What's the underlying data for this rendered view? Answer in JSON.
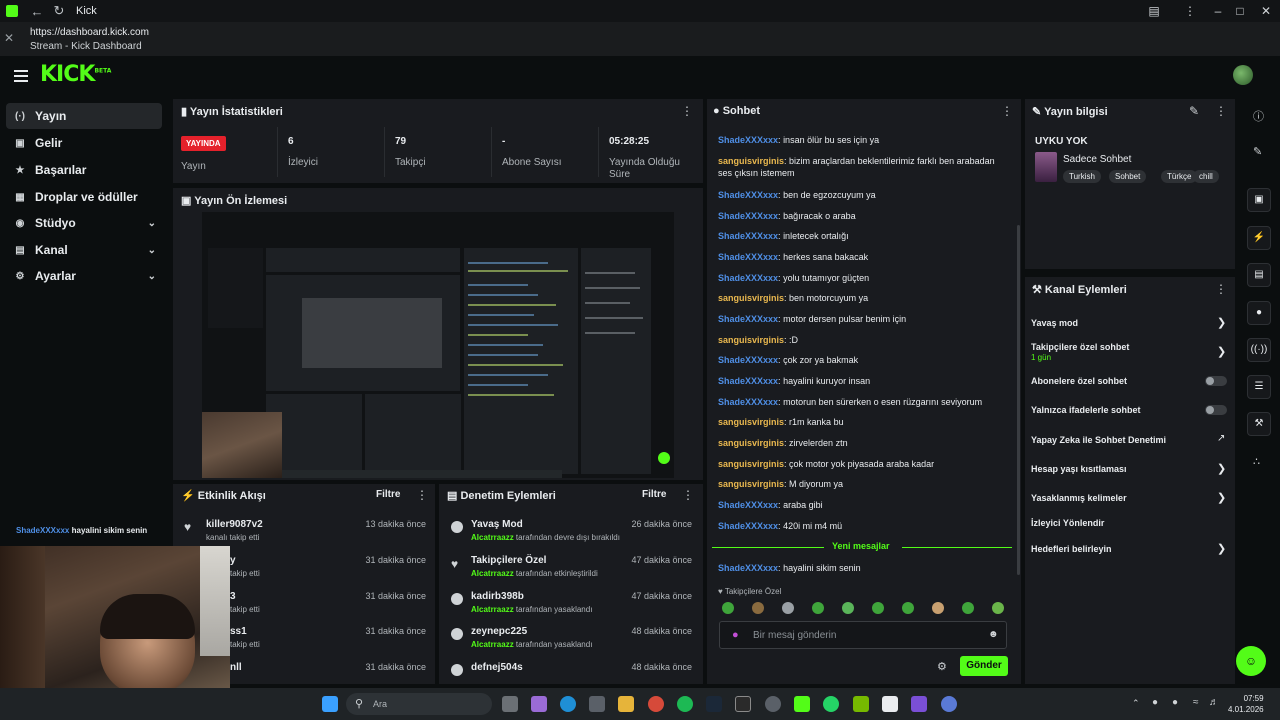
{
  "window": {
    "title": "Kick",
    "url": "https://dashboard.kick.com",
    "page_title": "Stream - Kick Dashboard"
  },
  "brand": {
    "logo_text": "KICK",
    "logo_sup": "BETA",
    "accent": "#53fc18"
  },
  "sidebar": {
    "items": [
      {
        "label": "Yayın",
        "icon": "broadcast-icon",
        "active": true
      },
      {
        "label": "Gelir",
        "icon": "wallet-icon"
      },
      {
        "label": "Başarılar",
        "icon": "trophy-icon"
      },
      {
        "label": "Droplar ve ödüller",
        "icon": "gift-icon"
      },
      {
        "label": "Stüdyo",
        "icon": "studio-icon",
        "expand": true
      },
      {
        "label": "Kanal",
        "icon": "channel-icon",
        "expand": true
      },
      {
        "label": "Ayarlar",
        "icon": "gear-icon",
        "expand": true
      }
    ]
  },
  "stats": {
    "title": "Yayın İstatistikleri",
    "live_badge": "YAYINDA",
    "status_label": "Yayın",
    "viewers_value": "6",
    "viewers_label": "İzleyici",
    "followers_value": "79",
    "followers_label": "Takipçi",
    "subs_value": "-",
    "subs_label": "Abone Sayısı",
    "uptime_value": "05:28:25",
    "uptime_label": "Yayında Olduğu Süre"
  },
  "preview": {
    "title": "Yayın Ön İzlemesi"
  },
  "activity": {
    "title": "Etkinlik Akışı",
    "filter": "Filtre",
    "rows": [
      {
        "name": "killer9087v2",
        "sub": "kanalı takip etti",
        "time": "13 dakika önce"
      },
      {
        "name": "y",
        "sub": "takip etti",
        "time": "31 dakika önce"
      },
      {
        "name": "3",
        "sub": "takip etti",
        "time": "31 dakika önce"
      },
      {
        "name": "ss1",
        "sub": "takip etti",
        "time": "31 dakika önce"
      },
      {
        "name": "nll",
        "sub": "",
        "time": "31 dakika önce"
      }
    ]
  },
  "moderation": {
    "title": "Denetim Eylemleri",
    "filter": "Filtre",
    "rows": [
      {
        "title": "Yavaş Mod",
        "who": "Alcatrraazz",
        "sub": "tarafından devre dışı bırakıldı",
        "time": "26 dakika önce",
        "icon": "snail-icon"
      },
      {
        "title": "Takipçilere Özel",
        "who": "Alcatrraazz",
        "sub": "tarafından etkinleştirildi",
        "time": "47 dakika önce",
        "icon": "heart-icon"
      },
      {
        "title": "kadirb398b",
        "who": "Alcatrraazz",
        "sub": "tarafından yasaklandı",
        "time": "47 dakika önce",
        "icon": "ban-icon"
      },
      {
        "title": "zeynepc225",
        "who": "Alcatrraazz",
        "sub": "tarafından yasaklandı",
        "time": "48 dakika önce",
        "icon": "ban-icon"
      },
      {
        "title": "defnej504s",
        "who": "Alcatrraazz",
        "sub": "tarafından yasaklandı",
        "time": "48 dakika önce",
        "icon": "ban-icon"
      }
    ]
  },
  "chat": {
    "title": "Sohbet",
    "messages": [
      {
        "user": "ShadeXXXxxx",
        "color": "blue",
        "text": "insan ölür bu ses için ya"
      },
      {
        "user": "sanguisvirginis",
        "color": "gold",
        "text": "bizim araçlardan beklentilerimiz farklı ben arabadan ses çıksın istemem"
      },
      {
        "user": "ShadeXXXxxx",
        "color": "blue",
        "text": "ben de egzozcuyum ya"
      },
      {
        "user": "ShadeXXXxxx",
        "color": "blue",
        "text": "bağıracak o araba"
      },
      {
        "user": "ShadeXXXxxx",
        "color": "blue",
        "text": "inletecek ortalığı"
      },
      {
        "user": "ShadeXXXxxx",
        "color": "blue",
        "text": "herkes sana bakacak"
      },
      {
        "user": "ShadeXXXxxx",
        "color": "blue",
        "text": "yolu tutamıyor güçten"
      },
      {
        "user": "sanguisvirginis",
        "color": "gold",
        "text": "ben motorcuyum ya"
      },
      {
        "user": "ShadeXXXxxx",
        "color": "blue",
        "text": "motor dersen pulsar benim için"
      },
      {
        "user": "sanguisvirginis",
        "color": "gold",
        "text": ":D"
      },
      {
        "user": "ShadeXXXxxx",
        "color": "blue",
        "text": "çok zor ya bakmak"
      },
      {
        "user": "ShadeXXXxxx",
        "color": "blue",
        "text": "hayalini kuruyor insan"
      },
      {
        "user": "ShadeXXXxxx",
        "color": "blue",
        "text": "motorun ben sürerken o esen rüzgarını seviyorum"
      },
      {
        "user": "sanguisvirginis",
        "color": "gold",
        "text": "r1m kanka bu"
      },
      {
        "user": "sanguisvirginis",
        "color": "gold",
        "text": "zirvelerden ztn"
      },
      {
        "user": "sanguisvirginis",
        "color": "gold",
        "text": "çok motor yok piyasada araba kadar"
      },
      {
        "user": "sanguisvirginis",
        "color": "gold",
        "text": "M diyorum ya"
      },
      {
        "user": "ShadeXXXxxx",
        "color": "blue",
        "text": "araba gibi"
      },
      {
        "user": "ShadeXXXxxx",
        "color": "blue",
        "text": "420i mi m4 mü"
      }
    ],
    "new_messages_label": "Yeni mesajlar",
    "latest": {
      "user": "ShadeXXXxxx",
      "text": "hayalini sikim senin"
    },
    "followers_only_label": "Takipçilere Özel",
    "input_placeholder": "Bir mesaj gönderin",
    "send_label": "Gönder"
  },
  "stream_info": {
    "title": "Yayın bilgisi",
    "stream_title": "UYKU YOK",
    "category": "Sadece Sohbet",
    "tags": [
      "Turkish",
      "Sohbet",
      "Türkçe",
      "chill"
    ]
  },
  "channel_actions": {
    "title": "Kanal Eylemleri",
    "items": [
      {
        "label": "Yavaş mod",
        "kind": "chevron"
      },
      {
        "label": "Takipçilere özel sohbet",
        "sub": "1 gün",
        "kind": "chevron"
      },
      {
        "label": "Abonelere özel sohbet",
        "kind": "toggle"
      },
      {
        "label": "Yalnızca ifadelerle sohbet",
        "kind": "toggle"
      },
      {
        "label": "Yapay Zeka ile Sohbet Denetimi",
        "kind": "external"
      },
      {
        "label": "Hesap yaşı kısıtlaması",
        "kind": "chevron"
      },
      {
        "label": "Yasaklanmış kelimeler",
        "kind": "chevron"
      },
      {
        "label": "İzleyici Yönlendir",
        "kind": "none"
      },
      {
        "label": "Hedefleri belirleyin",
        "kind": "chevron"
      }
    ]
  },
  "overlay_chat": {
    "user": "ShadeXXXxxx",
    "text": "hayalini sikim senin"
  },
  "taskbar": {
    "search_placeholder": "Ara",
    "time": "07:59",
    "date": "4.01.2026"
  }
}
